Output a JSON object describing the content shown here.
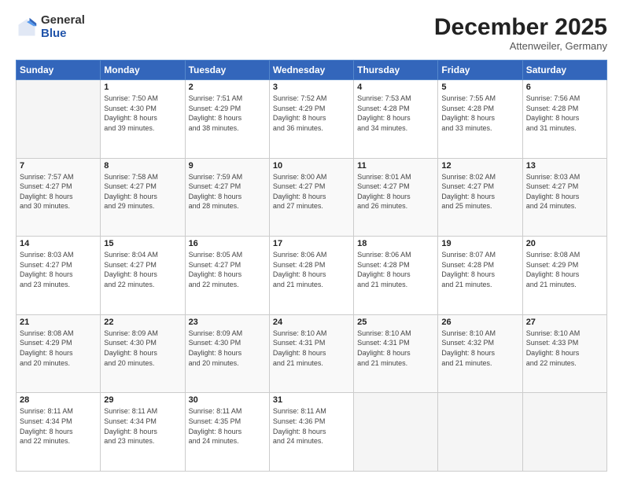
{
  "logo": {
    "general": "General",
    "blue": "Blue"
  },
  "header": {
    "month": "December 2025",
    "location": "Attenweiler, Germany"
  },
  "days_of_week": [
    "Sunday",
    "Monday",
    "Tuesday",
    "Wednesday",
    "Thursday",
    "Friday",
    "Saturday"
  ],
  "weeks": [
    [
      {
        "num": "",
        "info": ""
      },
      {
        "num": "1",
        "info": "Sunrise: 7:50 AM\nSunset: 4:30 PM\nDaylight: 8 hours\nand 39 minutes."
      },
      {
        "num": "2",
        "info": "Sunrise: 7:51 AM\nSunset: 4:29 PM\nDaylight: 8 hours\nand 38 minutes."
      },
      {
        "num": "3",
        "info": "Sunrise: 7:52 AM\nSunset: 4:29 PM\nDaylight: 8 hours\nand 36 minutes."
      },
      {
        "num": "4",
        "info": "Sunrise: 7:53 AM\nSunset: 4:28 PM\nDaylight: 8 hours\nand 34 minutes."
      },
      {
        "num": "5",
        "info": "Sunrise: 7:55 AM\nSunset: 4:28 PM\nDaylight: 8 hours\nand 33 minutes."
      },
      {
        "num": "6",
        "info": "Sunrise: 7:56 AM\nSunset: 4:28 PM\nDaylight: 8 hours\nand 31 minutes."
      }
    ],
    [
      {
        "num": "7",
        "info": "Sunrise: 7:57 AM\nSunset: 4:27 PM\nDaylight: 8 hours\nand 30 minutes."
      },
      {
        "num": "8",
        "info": "Sunrise: 7:58 AM\nSunset: 4:27 PM\nDaylight: 8 hours\nand 29 minutes."
      },
      {
        "num": "9",
        "info": "Sunrise: 7:59 AM\nSunset: 4:27 PM\nDaylight: 8 hours\nand 28 minutes."
      },
      {
        "num": "10",
        "info": "Sunrise: 8:00 AM\nSunset: 4:27 PM\nDaylight: 8 hours\nand 27 minutes."
      },
      {
        "num": "11",
        "info": "Sunrise: 8:01 AM\nSunset: 4:27 PM\nDaylight: 8 hours\nand 26 minutes."
      },
      {
        "num": "12",
        "info": "Sunrise: 8:02 AM\nSunset: 4:27 PM\nDaylight: 8 hours\nand 25 minutes."
      },
      {
        "num": "13",
        "info": "Sunrise: 8:03 AM\nSunset: 4:27 PM\nDaylight: 8 hours\nand 24 minutes."
      }
    ],
    [
      {
        "num": "14",
        "info": "Sunrise: 8:03 AM\nSunset: 4:27 PM\nDaylight: 8 hours\nand 23 minutes."
      },
      {
        "num": "15",
        "info": "Sunrise: 8:04 AM\nSunset: 4:27 PM\nDaylight: 8 hours\nand 22 minutes."
      },
      {
        "num": "16",
        "info": "Sunrise: 8:05 AM\nSunset: 4:27 PM\nDaylight: 8 hours\nand 22 minutes."
      },
      {
        "num": "17",
        "info": "Sunrise: 8:06 AM\nSunset: 4:28 PM\nDaylight: 8 hours\nand 21 minutes."
      },
      {
        "num": "18",
        "info": "Sunrise: 8:06 AM\nSunset: 4:28 PM\nDaylight: 8 hours\nand 21 minutes."
      },
      {
        "num": "19",
        "info": "Sunrise: 8:07 AM\nSunset: 4:28 PM\nDaylight: 8 hours\nand 21 minutes."
      },
      {
        "num": "20",
        "info": "Sunrise: 8:08 AM\nSunset: 4:29 PM\nDaylight: 8 hours\nand 21 minutes."
      }
    ],
    [
      {
        "num": "21",
        "info": "Sunrise: 8:08 AM\nSunset: 4:29 PM\nDaylight: 8 hours\nand 20 minutes."
      },
      {
        "num": "22",
        "info": "Sunrise: 8:09 AM\nSunset: 4:30 PM\nDaylight: 8 hours\nand 20 minutes."
      },
      {
        "num": "23",
        "info": "Sunrise: 8:09 AM\nSunset: 4:30 PM\nDaylight: 8 hours\nand 20 minutes."
      },
      {
        "num": "24",
        "info": "Sunrise: 8:10 AM\nSunset: 4:31 PM\nDaylight: 8 hours\nand 21 minutes."
      },
      {
        "num": "25",
        "info": "Sunrise: 8:10 AM\nSunset: 4:31 PM\nDaylight: 8 hours\nand 21 minutes."
      },
      {
        "num": "26",
        "info": "Sunrise: 8:10 AM\nSunset: 4:32 PM\nDaylight: 8 hours\nand 21 minutes."
      },
      {
        "num": "27",
        "info": "Sunrise: 8:10 AM\nSunset: 4:33 PM\nDaylight: 8 hours\nand 22 minutes."
      }
    ],
    [
      {
        "num": "28",
        "info": "Sunrise: 8:11 AM\nSunset: 4:34 PM\nDaylight: 8 hours\nand 22 minutes."
      },
      {
        "num": "29",
        "info": "Sunrise: 8:11 AM\nSunset: 4:34 PM\nDaylight: 8 hours\nand 23 minutes."
      },
      {
        "num": "30",
        "info": "Sunrise: 8:11 AM\nSunset: 4:35 PM\nDaylight: 8 hours\nand 24 minutes."
      },
      {
        "num": "31",
        "info": "Sunrise: 8:11 AM\nSunset: 4:36 PM\nDaylight: 8 hours\nand 24 minutes."
      },
      {
        "num": "",
        "info": ""
      },
      {
        "num": "",
        "info": ""
      },
      {
        "num": "",
        "info": ""
      }
    ]
  ]
}
